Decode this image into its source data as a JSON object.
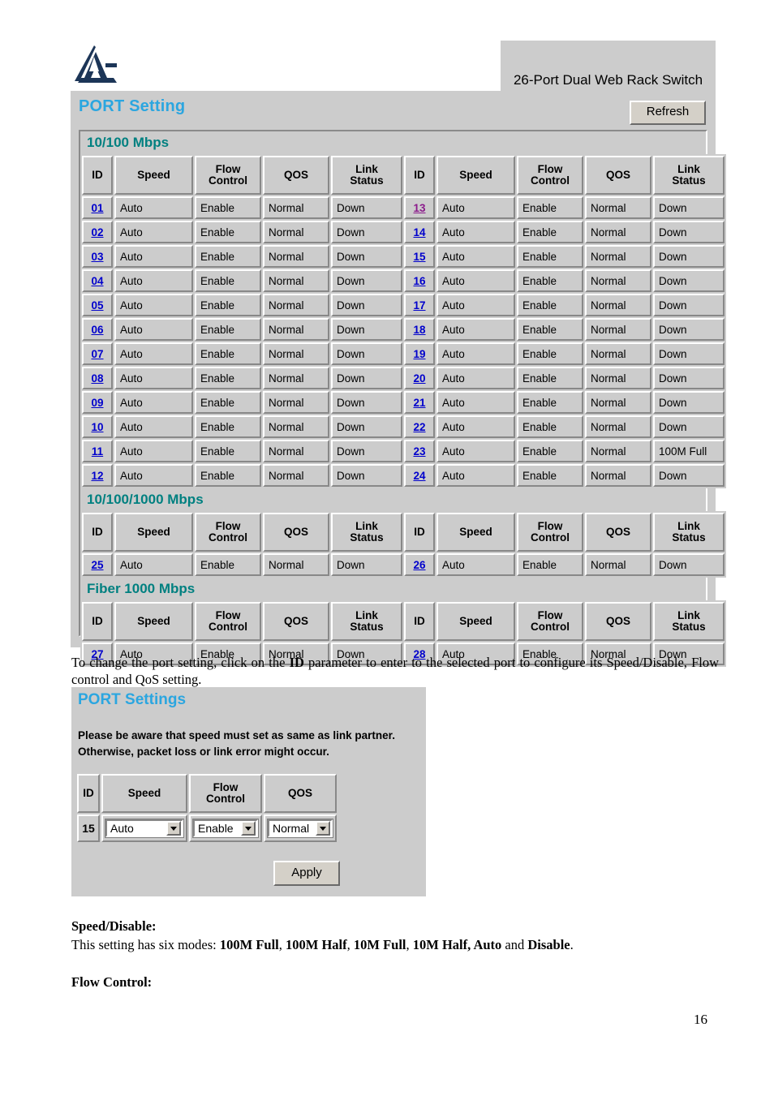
{
  "document": {
    "page_number": "16"
  },
  "header": {
    "device_title": "26-Port Dual Web Rack Switch",
    "logo_name": "atlantis-land-logo"
  },
  "port_setting_panel": {
    "title": "PORT Setting",
    "refresh_label": "Refresh",
    "columns": [
      "ID",
      "Speed",
      "Flow\nControl",
      "QOS",
      "Link\nStatus"
    ],
    "column_labels": {
      "id": "ID",
      "speed": "Speed",
      "flow_control_line1": "Flow",
      "flow_control_line2": "Control",
      "qos": "QOS",
      "link_status_line1": "Link",
      "link_status_line2": "Status"
    },
    "sections": [
      {
        "title": "10/100 Mbps",
        "rows": [
          {
            "left": {
              "id": "01",
              "visited": false,
              "speed": "Auto",
              "flow": "Enable",
              "qos": "Normal",
              "link": "Down"
            },
            "right": {
              "id": "13",
              "visited": true,
              "speed": "Auto",
              "flow": "Enable",
              "qos": "Normal",
              "link": "Down"
            }
          },
          {
            "left": {
              "id": "02",
              "visited": false,
              "speed": "Auto",
              "flow": "Enable",
              "qos": "Normal",
              "link": "Down"
            },
            "right": {
              "id": "14",
              "visited": false,
              "speed": "Auto",
              "flow": "Enable",
              "qos": "Normal",
              "link": "Down"
            }
          },
          {
            "left": {
              "id": "03",
              "visited": false,
              "speed": "Auto",
              "flow": "Enable",
              "qos": "Normal",
              "link": "Down"
            },
            "right": {
              "id": "15",
              "visited": false,
              "speed": "Auto",
              "flow": "Enable",
              "qos": "Normal",
              "link": "Down"
            }
          },
          {
            "left": {
              "id": "04",
              "visited": false,
              "speed": "Auto",
              "flow": "Enable",
              "qos": "Normal",
              "link": "Down"
            },
            "right": {
              "id": "16",
              "visited": false,
              "speed": "Auto",
              "flow": "Enable",
              "qos": "Normal",
              "link": "Down"
            }
          },
          {
            "left": {
              "id": "05",
              "visited": false,
              "speed": "Auto",
              "flow": "Enable",
              "qos": "Normal",
              "link": "Down"
            },
            "right": {
              "id": "17",
              "visited": false,
              "speed": "Auto",
              "flow": "Enable",
              "qos": "Normal",
              "link": "Down"
            }
          },
          {
            "left": {
              "id": "06",
              "visited": false,
              "speed": "Auto",
              "flow": "Enable",
              "qos": "Normal",
              "link": "Down"
            },
            "right": {
              "id": "18",
              "visited": false,
              "speed": "Auto",
              "flow": "Enable",
              "qos": "Normal",
              "link": "Down"
            }
          },
          {
            "left": {
              "id": "07",
              "visited": false,
              "speed": "Auto",
              "flow": "Enable",
              "qos": "Normal",
              "link": "Down"
            },
            "right": {
              "id": "19",
              "visited": false,
              "speed": "Auto",
              "flow": "Enable",
              "qos": "Normal",
              "link": "Down"
            }
          },
          {
            "left": {
              "id": "08",
              "visited": false,
              "speed": "Auto",
              "flow": "Enable",
              "qos": "Normal",
              "link": "Down"
            },
            "right": {
              "id": "20",
              "visited": false,
              "speed": "Auto",
              "flow": "Enable",
              "qos": "Normal",
              "link": "Down"
            }
          },
          {
            "left": {
              "id": "09",
              "visited": false,
              "speed": "Auto",
              "flow": "Enable",
              "qos": "Normal",
              "link": "Down"
            },
            "right": {
              "id": "21",
              "visited": false,
              "speed": "Auto",
              "flow": "Enable",
              "qos": "Normal",
              "link": "Down"
            }
          },
          {
            "left": {
              "id": "10",
              "visited": false,
              "speed": "Auto",
              "flow": "Enable",
              "qos": "Normal",
              "link": "Down"
            },
            "right": {
              "id": "22",
              "visited": false,
              "speed": "Auto",
              "flow": "Enable",
              "qos": "Normal",
              "link": "Down"
            }
          },
          {
            "left": {
              "id": "11",
              "visited": false,
              "speed": "Auto",
              "flow": "Enable",
              "qos": "Normal",
              "link": "Down"
            },
            "right": {
              "id": "23",
              "visited": false,
              "speed": "Auto",
              "flow": "Enable",
              "qos": "Normal",
              "link": "100M Full"
            }
          },
          {
            "left": {
              "id": "12",
              "visited": false,
              "speed": "Auto",
              "flow": "Enable",
              "qos": "Normal",
              "link": "Down"
            },
            "right": {
              "id": "24",
              "visited": false,
              "speed": "Auto",
              "flow": "Enable",
              "qos": "Normal",
              "link": "Down"
            }
          }
        ]
      },
      {
        "title": "10/100/1000 Mbps",
        "rows": [
          {
            "left": {
              "id": "25",
              "visited": false,
              "speed": "Auto",
              "flow": "Enable",
              "qos": "Normal",
              "link": "Down"
            },
            "right": {
              "id": "26",
              "visited": false,
              "speed": "Auto",
              "flow": "Enable",
              "qos": "Normal",
              "link": "Down"
            }
          }
        ]
      },
      {
        "title": "Fiber 1000 Mbps",
        "rows": [
          {
            "left": {
              "id": "27",
              "visited": false,
              "speed": "Auto",
              "flow": "Enable",
              "qos": "Normal",
              "link": "Down"
            },
            "right": {
              "id": "28",
              "visited": false,
              "speed": "Auto",
              "flow": "Enable",
              "qos": "Normal",
              "link": "Down"
            }
          }
        ]
      }
    ]
  },
  "instruction_paragraph": {
    "part1": "To change the port setting, click on the ",
    "bold1": "ID",
    "part2": " parameter to enter to the selected port to configure its Speed/Disable, Flow control and QoS setting."
  },
  "port_settings_dialog": {
    "title": "PORT Settings",
    "warning_line1": "Please be aware that speed must set as same as link partner.",
    "warning_line2": "Otherwise, packet loss or link error might occur.",
    "columns": {
      "id": "ID",
      "speed": "Speed",
      "flow_control_line1": "Flow",
      "flow_control_line2": "Control",
      "qos": "QOS"
    },
    "row": {
      "id": "15",
      "speed_value": "Auto",
      "flow_value": "Enable",
      "qos_value": "Normal"
    },
    "apply_label": "Apply"
  },
  "descriptions": {
    "speed_heading": "Speed/Disable:",
    "speed_text_prefix": "This setting has six modes: ",
    "modes": [
      "100M Full",
      "100M Half",
      "10M Full",
      "10M Half, Auto"
    ],
    "modes_joiner": " and ",
    "mode_last": "Disable",
    "mode_period": ".",
    "flow_heading": "Flow Control:"
  },
  "colors": {
    "panel_grey": "#cccccc",
    "title_blue": "#2ba6e0",
    "section_teal": "#008080",
    "link_blue": "#0000cc",
    "link_visited": "#8b1a8b",
    "logo_navy": "#1c3557"
  }
}
